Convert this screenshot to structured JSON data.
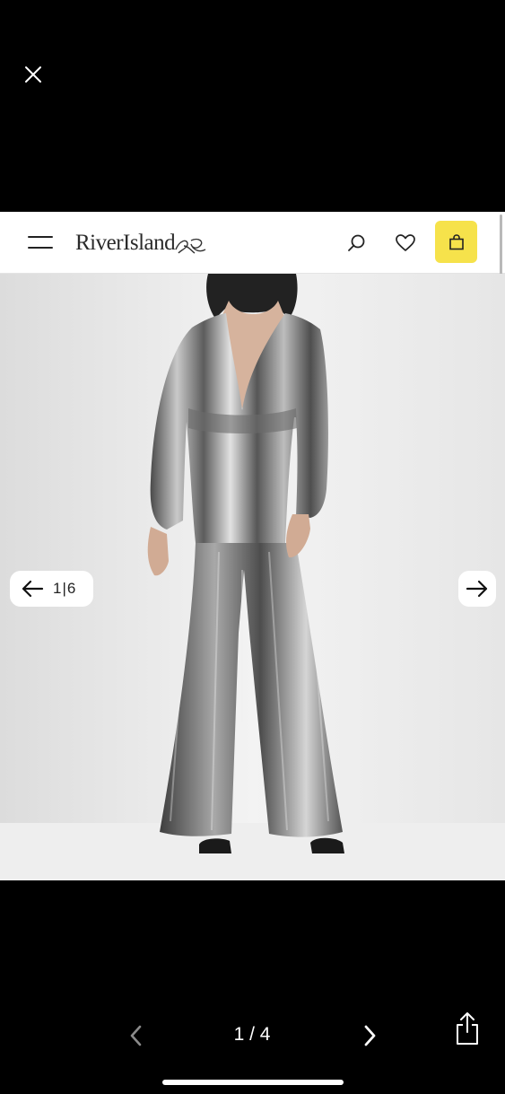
{
  "viewer": {
    "close_icon": "close-icon",
    "page_indicator": "1 / 4",
    "nav_prev_icon": "chevron-left-icon",
    "nav_next_icon": "chevron-right-icon",
    "share_icon": "share-icon",
    "nav_prev_disabled_color": "#8a8a8a",
    "icon_color": "#ffffff"
  },
  "site": {
    "brand": "RiverIsland",
    "menu_icon": "menu-icon",
    "search_icon": "search-icon",
    "wishlist_icon": "heart-icon",
    "bag_icon": "shopping-bag-icon",
    "bag_color": "#f6e24b"
  },
  "gallery": {
    "counter": "1|6",
    "prev_icon": "arrow-left-icon",
    "next_icon": "arrow-right-icon",
    "image_subject": "model in silver metallic plunge-neck wide-leg jumpsuit"
  }
}
